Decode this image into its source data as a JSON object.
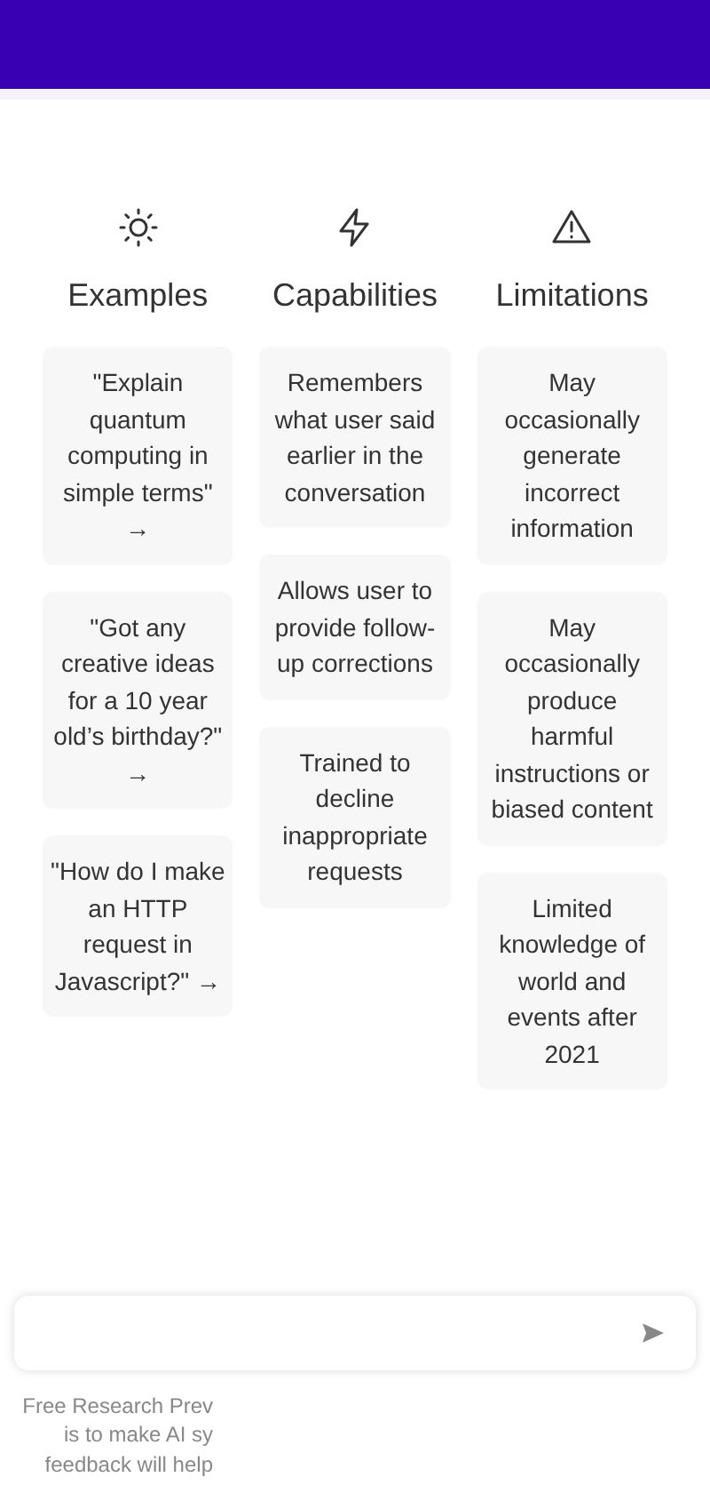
{
  "columns": [
    {
      "kind": "sun",
      "title": "Examples",
      "cards": [
        {
          "text": "\"Explain quantum computing in simple terms\" →"
        },
        {
          "text": "\"Got any creative ideas for a 10 year old’s birthday?\" →"
        },
        {
          "text": "\"How do I make an HTTP request in Javascript?\" →"
        }
      ]
    },
    {
      "kind": "bolt",
      "title": "Capabilities",
      "cards": [
        {
          "text": "Remembers what user said earlier in the conversation"
        },
        {
          "text": "Allows user to provide follow-up corrections"
        },
        {
          "text": "Trained to decline inappropriate requests"
        }
      ]
    },
    {
      "kind": "warning",
      "title": "Limitations",
      "cards": [
        {
          "text": "May occasionally generate incorrect information"
        },
        {
          "text": "May occasionally produce harmful instructions or biased content"
        },
        {
          "text": "Limited knowledge of world and events after 2021"
        }
      ]
    }
  ],
  "footer": [
    "Free Research Prev",
    "is to make AI sy",
    "feedback will help"
  ]
}
